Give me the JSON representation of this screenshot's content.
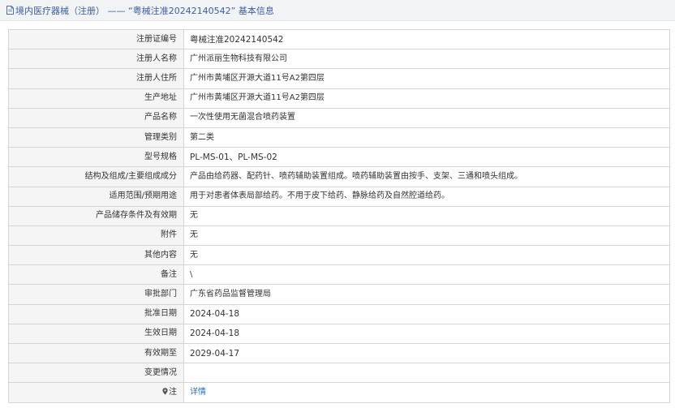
{
  "header": {
    "title": "境内医疗器械（注册） —— “粤械注准20242140542” 基本信息"
  },
  "rows": [
    {
      "label": "注册证编号",
      "value": "粤械注准20242140542"
    },
    {
      "label": "注册人名称",
      "value": "广州派丽生物科技有限公司"
    },
    {
      "label": "注册人住所",
      "value": "广州市黄埔区开源大道11号A2第四层"
    },
    {
      "label": "生产地址",
      "value": "广州市黄埔区开源大道11号A2第四层"
    },
    {
      "label": "产品名称",
      "value": "一次性使用无菌混合喷药装置"
    },
    {
      "label": "管理类别",
      "value": "第二类"
    },
    {
      "label": "型号规格",
      "value": "PL-MS-01、PL-MS-02"
    },
    {
      "label": "结构及组成/主要组成成分",
      "value": "产品由给药器、配药针、喷药辅助装置组成。喷药辅助装置由按手、支架、三通和喷头组成。"
    },
    {
      "label": "适用范围/预期用途",
      "value": "用于对患者体表局部给药。不用于皮下给药、静脉给药及自然腔道给药。"
    },
    {
      "label": "产品储存条件及有效期",
      "value": "无"
    },
    {
      "label": "附件",
      "value": "无"
    },
    {
      "label": "其他内容",
      "value": "无"
    },
    {
      "label": "备注",
      "value": "\\"
    },
    {
      "label": "审批部门",
      "value": "广东省药品监督管理局"
    },
    {
      "label": "批准日期",
      "value": "2024-04-18"
    },
    {
      "label": "生效日期",
      "value": "2024-04-18"
    },
    {
      "label": "有效期至",
      "value": "2029-04-17"
    },
    {
      "label": "变更情况",
      "value": ""
    },
    {
      "label": "注",
      "value": "详情"
    }
  ]
}
